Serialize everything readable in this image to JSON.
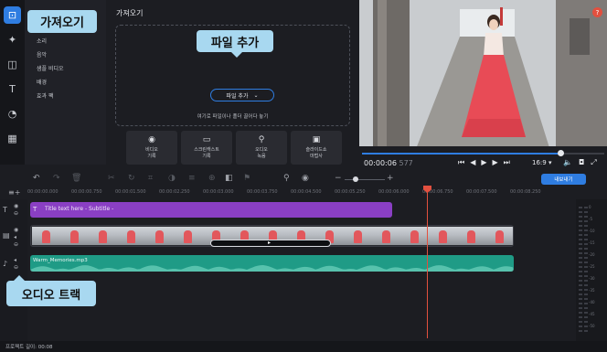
{
  "rail": {
    "icons": [
      "import-icon",
      "magic-wand-icon",
      "transitions-icon",
      "titles-icon",
      "stickers-icon",
      "more-tools-icon"
    ]
  },
  "categories": [
    "소리",
    "음악",
    "샘플 비디오",
    "배경",
    "효과 팩"
  ],
  "import_panel": {
    "title": "가져오기",
    "add_file_label": "파일 추가",
    "drop_hint": "여기로 파일이나 폴더 끌어다 놓기",
    "tiles": [
      {
        "icon": "webcam-icon",
        "label": "비디오\n기록"
      },
      {
        "icon": "screencast-icon",
        "label": "스크린캐스트\n기록"
      },
      {
        "icon": "microphone-icon",
        "label": "오디오\n녹음"
      },
      {
        "icon": "slideshow-icon",
        "label": "슬라이드쇼\n마법사"
      }
    ]
  },
  "player": {
    "help_label": "?",
    "timecode": "00:00:06",
    "timecode_ms": "577",
    "aspect_ratio": "16:9 ▾",
    "progress_fraction": 0.82
  },
  "toolbar": {
    "export_label": "내보내기",
    "zoom_fraction": 0.2
  },
  "ruler": {
    "ticks": [
      "00:00:00.000",
      "00:00:00.750",
      "00:00:01.500",
      "00:00:02.250",
      "00:00:03.000",
      "00:00:03.750",
      "00:00:04.500",
      "00:00:05.250",
      "00:00:06.000",
      "00:00:06.750",
      "00:00:07.500",
      "00:00:08.250"
    ]
  },
  "timeline": {
    "title_clip_label": "Title text here - Subtitle -",
    "audio_clip_label": "Warm_Memories.mp3"
  },
  "vu_meter": {
    "levels": [
      "0",
      "-5",
      "-10",
      "-15",
      "-20",
      "-25",
      "-30",
      "-35",
      "-40",
      "-45",
      "-50"
    ]
  },
  "status": {
    "project_length": "프로젝트 길이: 00:08"
  },
  "callouts": {
    "import": "가져오기",
    "add_file": "파일 추가",
    "audio_track": "오디오 트랙"
  },
  "colors": {
    "accent": "#2f7de1",
    "title_clip": "#8a3fc4",
    "audio_clip": "#1f9b86",
    "playhead": "#e2503f",
    "callout": "#a8d8f0"
  }
}
